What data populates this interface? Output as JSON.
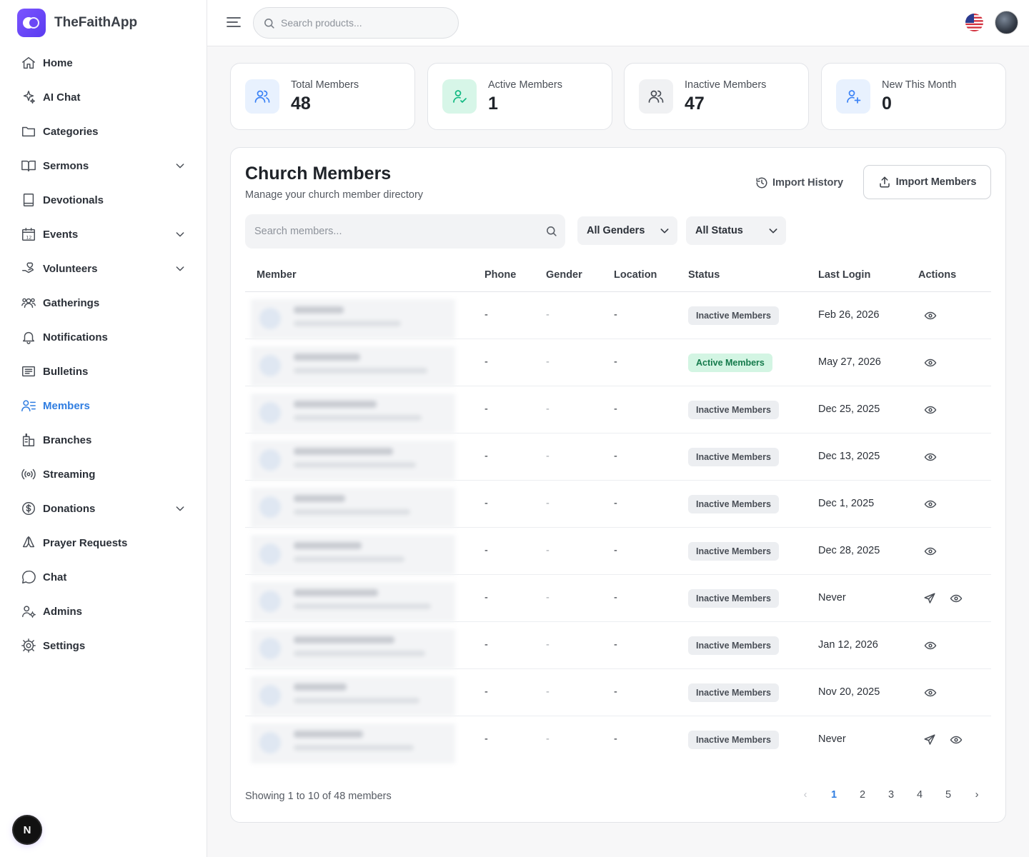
{
  "brand": {
    "name": "TheFaithApp"
  },
  "sidebar": {
    "items": [
      {
        "label": "Home",
        "icon": "home-icon",
        "chevron": false,
        "active": false
      },
      {
        "label": "AI Chat",
        "icon": "sparkle-icon",
        "chevron": false,
        "active": false
      },
      {
        "label": "Categories",
        "icon": "folder-icon",
        "chevron": false,
        "active": false
      },
      {
        "label": "Sermons",
        "icon": "book-open-icon",
        "chevron": true,
        "active": false
      },
      {
        "label": "Devotionals",
        "icon": "book-icon",
        "chevron": false,
        "active": false
      },
      {
        "label": "Events",
        "icon": "calendar-icon",
        "chevron": true,
        "active": false
      },
      {
        "label": "Volunteers",
        "icon": "hand-heart-icon",
        "chevron": true,
        "active": false
      },
      {
        "label": "Gatherings",
        "icon": "users-group-icon",
        "chevron": false,
        "active": false
      },
      {
        "label": "Notifications",
        "icon": "bell-icon",
        "chevron": false,
        "active": false
      },
      {
        "label": "Bulletins",
        "icon": "newspaper-icon",
        "chevron": false,
        "active": false
      },
      {
        "label": "Members",
        "icon": "user-list-icon",
        "chevron": false,
        "active": true
      },
      {
        "label": "Branches",
        "icon": "building-icon",
        "chevron": false,
        "active": false
      },
      {
        "label": "Streaming",
        "icon": "broadcast-icon",
        "chevron": false,
        "active": false
      },
      {
        "label": "Donations",
        "icon": "dollar-circle-icon",
        "chevron": true,
        "active": false
      },
      {
        "label": "Prayer Requests",
        "icon": "praying-hands-icon",
        "chevron": false,
        "active": false
      },
      {
        "label": "Chat",
        "icon": "chat-bubble-icon",
        "chevron": false,
        "active": false
      },
      {
        "label": "Admins",
        "icon": "user-gear-icon",
        "chevron": false,
        "active": false
      },
      {
        "label": "Settings",
        "icon": "gear-icon",
        "chevron": false,
        "active": false
      }
    ],
    "bottom_badge": "N"
  },
  "topbar": {
    "search_placeholder": "Search products..."
  },
  "stats": [
    {
      "label": "Total Members",
      "value": "48",
      "icon": "users-icon",
      "color": "#3b82f6",
      "bg": "#e8f1fe"
    },
    {
      "label": "Active Members",
      "value": "1",
      "icon": "user-check-icon",
      "color": "#10b981",
      "bg": "#d7f6e8"
    },
    {
      "label": "Inactive Members",
      "value": "47",
      "icon": "users-icon",
      "color": "#4a4f57",
      "bg": "#f0f1f3"
    },
    {
      "label": "New This Month",
      "value": "0",
      "icon": "user-plus-icon",
      "color": "#3b82f6",
      "bg": "#e8f1fe"
    }
  ],
  "members": {
    "title": "Church Members",
    "subtitle": "Manage your church member directory",
    "import_history_label": "Import History",
    "import_members_label": "Import Members",
    "search_placeholder": "Search members...",
    "gender_filter": "All Genders",
    "status_filter": "All Status",
    "columns": [
      "Member",
      "Phone",
      "Gender",
      "Location",
      "Status",
      "Last Login",
      "Actions"
    ],
    "rows": [
      {
        "phone": "-",
        "gender": "-",
        "location": "-",
        "status": "Inactive Members",
        "active": false,
        "last_login": "Feb 26, 2026",
        "send": false
      },
      {
        "phone": "-",
        "gender": "-",
        "location": "-",
        "status": "Active Members",
        "active": true,
        "last_login": "May 27, 2026",
        "send": false
      },
      {
        "phone": "-",
        "gender": "-",
        "location": "-",
        "status": "Inactive Members",
        "active": false,
        "last_login": "Dec 25, 2025",
        "send": false
      },
      {
        "phone": "-",
        "gender": "-",
        "location": "-",
        "status": "Inactive Members",
        "active": false,
        "last_login": "Dec 13, 2025",
        "send": false
      },
      {
        "phone": "-",
        "gender": "-",
        "location": "-",
        "status": "Inactive Members",
        "active": false,
        "last_login": "Dec 1, 2025",
        "send": false
      },
      {
        "phone": "-",
        "gender": "-",
        "location": "-",
        "status": "Inactive Members",
        "active": false,
        "last_login": "Dec 28, 2025",
        "send": false
      },
      {
        "phone": "-",
        "gender": "-",
        "location": "-",
        "status": "Inactive Members",
        "active": false,
        "last_login": "Never",
        "send": true
      },
      {
        "phone": "-",
        "gender": "-",
        "location": "-",
        "status": "Inactive Members",
        "active": false,
        "last_login": "Jan 12, 2026",
        "send": false
      },
      {
        "phone": "-",
        "gender": "-",
        "location": "-",
        "status": "Inactive Members",
        "active": false,
        "last_login": "Nov 20, 2025",
        "send": false
      },
      {
        "phone": "-",
        "gender": "-",
        "location": "-",
        "status": "Inactive Members",
        "active": false,
        "last_login": "Never",
        "send": true
      }
    ],
    "showing": "Showing 1 to 10 of 48 members",
    "pagination": {
      "prev": "‹",
      "pages": [
        "1",
        "2",
        "3",
        "4",
        "5"
      ],
      "current": "1",
      "next": "›"
    }
  },
  "colors": {
    "accent": "#2f7de1",
    "active_badge_bg": "#d3f5e3",
    "active_badge_text": "#147a4b"
  }
}
